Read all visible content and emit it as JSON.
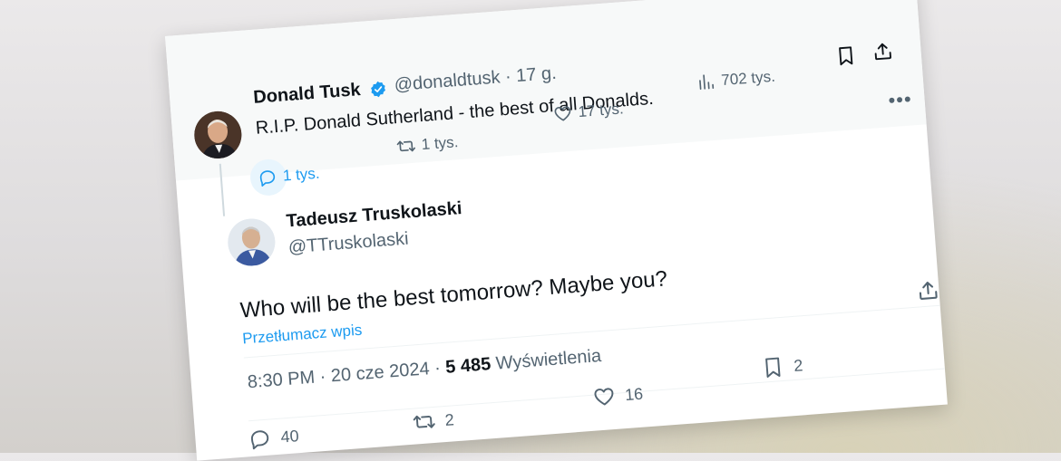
{
  "quoted_tweet": {
    "author_name": "Donald Tusk",
    "handle_time": "@donaldtusk · 17 g.",
    "text": "R.I.P. Donald Sutherland - the best of all Donalds.",
    "replies": "1 tys.",
    "retweets": "1 tys.",
    "likes": "17 tys.",
    "views": "702 tys."
  },
  "reply_tweet": {
    "author_name": "Tadeusz Truskolaski",
    "handle": "@TTruskolaski",
    "text": "Who will be the best tomorrow? Maybe you?",
    "translate_link": "Przetłumacz wpis",
    "time_date": "8:30 PM · 20 cze 2024 · ",
    "view_count": "5 485",
    "views_label": " Wyświetlenia",
    "replies": "40",
    "retweets": "2",
    "likes": "16",
    "bookmarks": "2"
  },
  "colors": {
    "accent": "#1d9bf0",
    "text_primary": "#0f1419",
    "text_secondary": "#536471"
  },
  "icons": [
    "verified-badge-icon",
    "reply-icon",
    "retweet-icon",
    "like-icon",
    "views-icon",
    "bookmark-icon",
    "share-icon",
    "more-icon"
  ]
}
